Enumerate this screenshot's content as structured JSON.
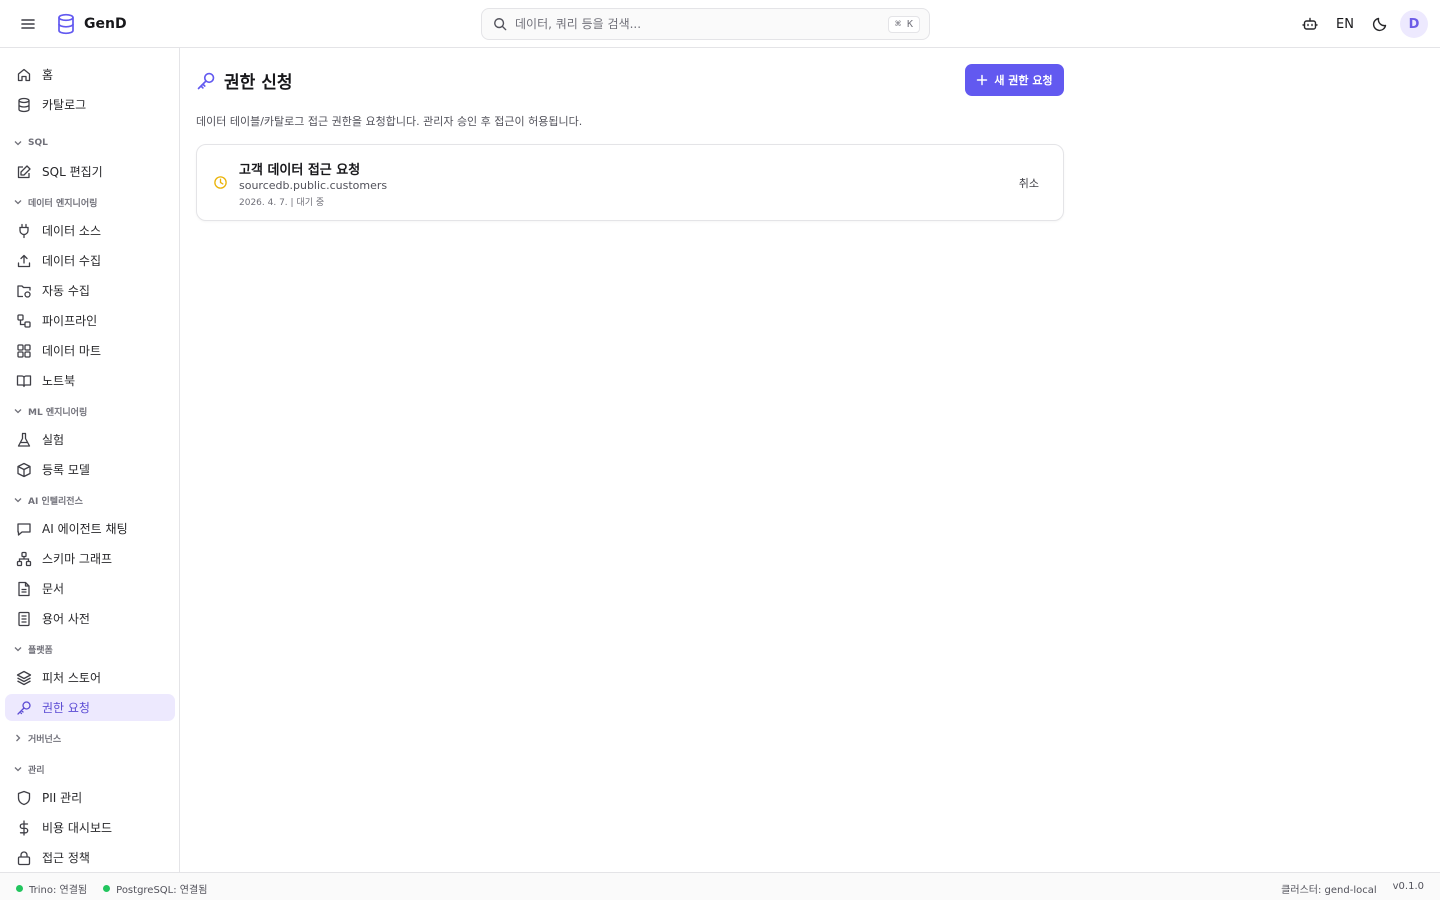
{
  "app": {
    "name": "GenD"
  },
  "search": {
    "placeholder": "데이터, 쿼리 등을 검색...",
    "shortcut": "⌘ K"
  },
  "header": {
    "language": "EN",
    "avatar_initial": "D"
  },
  "colors": {
    "accent": "#6259f0",
    "active_bg": "#ede9fe",
    "status_ok": "#22c55e",
    "pending": "#eab308"
  },
  "sidebar": {
    "home": "홈",
    "catalog": "카탈로그",
    "sections": {
      "sql": "SQL",
      "data_eng": "데이터 엔지니어링",
      "ml_eng": "ML 엔지니어링",
      "ai": "AI 인텔리전스",
      "platform": "플랫폼",
      "governance": "거버넌스",
      "admin": "관리"
    },
    "items": {
      "sql_editor": "SQL 편집기",
      "data_source": "데이터 소스",
      "data_ingest": "데이터 수집",
      "auto_ingest": "자동 수집",
      "pipeline": "파이프라인",
      "data_mart": "데이터 마트",
      "notebook": "노트북",
      "experiment": "실험",
      "registered_model": "등록 모델",
      "ai_chat": "AI 에이전트 채팅",
      "schema_graph": "스키마 그래프",
      "documents": "문서",
      "glossary": "용어 사전",
      "feature_store": "피처 스토어",
      "access_request": "권한 요청",
      "pii": "PII 관리",
      "cost_dashboard": "비용 대시보드",
      "access_policy": "접근 정책"
    }
  },
  "page": {
    "title": "권한 신청",
    "new_button": "새 권한 요청",
    "description": "데이터 테이블/카탈로그 접근 권한을 요청합니다. 관리자 승인 후 접근이 허용됩니다."
  },
  "requests": [
    {
      "title": "고객 데이터 접근 요청",
      "resource": "sourcedb.public.customers",
      "meta": "2026. 4. 7. | 대기 중",
      "cancel_label": "취소"
    }
  ],
  "statusbar": {
    "trino": "Trino: 연결됨",
    "postgres": "PostgreSQL: 연결됨",
    "cluster": "클러스터: gend-local",
    "version": "v0.1.0"
  }
}
